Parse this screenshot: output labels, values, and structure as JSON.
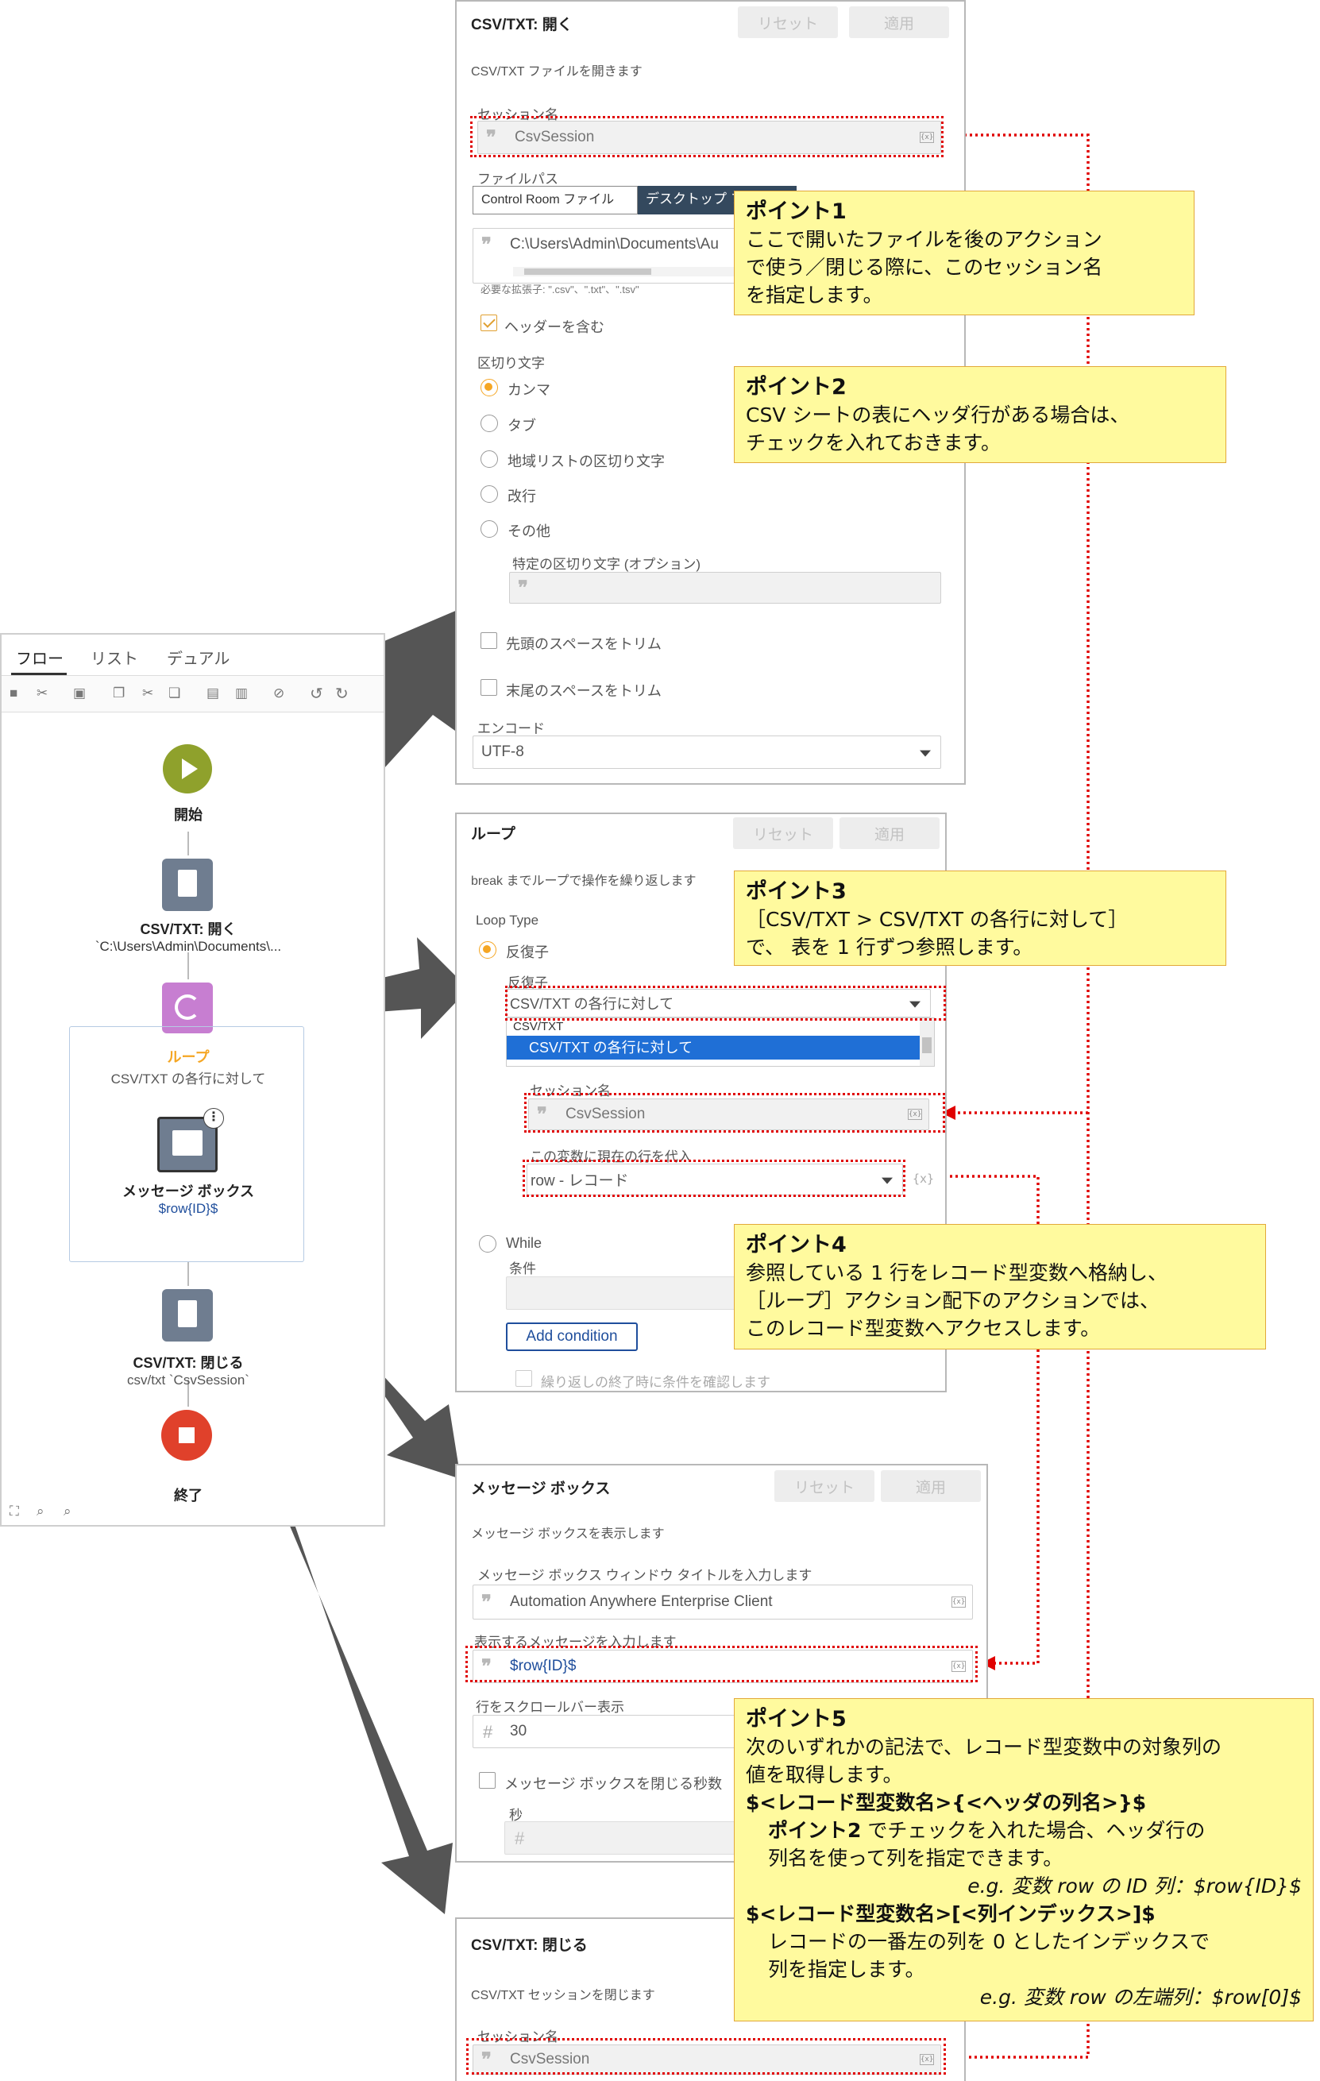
{
  "flow_panel": {
    "tabs": [
      "フロー",
      "リスト",
      "デュアル"
    ],
    "nodes": {
      "start": "開始",
      "open_title": "CSV/TXT: 開く",
      "open_sub": "`C:\\Users\\Admin\\Documents\\...",
      "loop_title": "ループ",
      "loop_sub": "CSV/TXT の各行に対して",
      "msg_title": "メッセージ ボックス",
      "msg_sub": "$row{ID}$",
      "close_title": "CSV/TXT: 閉じる",
      "close_sub": "csv/txt `CsvSession`",
      "end": "終了"
    }
  },
  "open_panel": {
    "title": "CSV/TXT: 開く",
    "reset": "リセット",
    "apply": "適用",
    "desc": "CSV/TXT ファイルを開きます",
    "session_label": "セッション名",
    "session_value": "CsvSession",
    "file_path_label": "ファイルパス",
    "tab_control_room": "Control Room ファイル",
    "tab_desktop": "デスクトップ ファイル",
    "path_value": "C:\\Users\\Admin\\Documents\\Au",
    "extensions": "必要な拡張子: \".csv\"、\".txt\"、\".tsv\"",
    "header_check": "ヘッダーを含む",
    "delimiter_label": "区切り文字",
    "delimiters": [
      "カンマ",
      "タブ",
      "地域リストの区切り文字",
      "改行",
      "その他"
    ],
    "specific_delim": "特定の区切り文字 (オプション)",
    "trim_leading": "先頭のスペースをトリム",
    "trim_trailing": "末尾のスペースをトリム",
    "encode_label": "エンコード",
    "encode_value": "UTF-8"
  },
  "loop_panel": {
    "title": "ループ",
    "reset": "リセット",
    "apply": "適用",
    "desc": "break までループで操作を繰り返します",
    "loop_type": "Loop Type",
    "iterator_radio": "反復子",
    "iterator_label": "反復子",
    "iterator_value": "CSV/TXT の各行に対して",
    "dropdown_group": "CSV/TXT",
    "dropdown_selected": "CSV/TXT の各行に対して",
    "session_label": "セッション名",
    "session_value": "CsvSession",
    "assign_label": "この変数に現在の行を代入",
    "assign_value": "row - レコード",
    "while_radio": "While",
    "condition_label": "条件",
    "add_condition": "Add condition",
    "check_end": "繰り返しの終了時に条件を確認します"
  },
  "msg_panel": {
    "title": "メッセージ ボックス",
    "reset": "リセット",
    "apply": "適用",
    "desc": "メッセージ ボックスを表示します",
    "window_title_label": "メッセージ ボックス ウィンドウ タイトルを入力します",
    "window_title_value": "Automation Anywhere Enterprise Client",
    "message_label": "表示するメッセージを入力します",
    "message_value": "$row{ID}$",
    "scroll_label": "行をスクロールバー表示",
    "scroll_value": "30",
    "close_check": "メッセージ ボックスを閉じる秒数",
    "seconds_label": "秒"
  },
  "close_panel": {
    "title": "CSV/TXT: 閉じる",
    "desc": "CSV/TXT セッションを閉じます",
    "session_label": "セッション名",
    "session_value": "CsvSession"
  },
  "callouts": {
    "p1_title": "ポイント1",
    "p1_text": [
      "ここで開いたファイルを後のアクション",
      "で使う／閉じる際に、このセッション名",
      "を指定します。"
    ],
    "p2_title": "ポイント2",
    "p2_text": [
      "CSV シートの表にヘッダ行がある場合は、",
      "チェックを入れておきます。"
    ],
    "p3_title": "ポイント3",
    "p3_text": [
      "［CSV/TXT > CSV/TXT の各行に対して］",
      "で、 表を 1 行ずつ参照します。"
    ],
    "p4_title": "ポイント4",
    "p4_text": [
      "参照している 1 行をレコード型変数へ格納し、",
      "［ループ］アクション配下のアクションでは、",
      "このレコード型変数へアクセスします。"
    ],
    "p5_title": "ポイント5",
    "p5_line1": "次のいずれかの記法で、レコード型変数中の対象列の",
    "p5_line2": "値を取得します。",
    "p5_syntax1": "$<レコード型変数名>{<ヘッダの列名>}$",
    "p5_s1_bold": "ポイント2",
    "p5_s1_rest": " でチェックを入れた場合、ヘッダ行の",
    "p5_s1_line2": "列名を使って列を指定できます。",
    "p5_s1_example": "e.g. 変数 row の ID 列：$row{ID}$",
    "p5_syntax2": "$<レコード型変数名>[<列インデックス>]$",
    "p5_s2_line1": "レコードの一番左の列を 0 としたインデックスで",
    "p5_s2_line2": "列を指定します。",
    "p5_s2_example": "e.g. 変数 row の左端列：$row[0]$"
  },
  "colors": {
    "highlight_red": "#e00000",
    "callout_fill": "#fffa9e",
    "accent_orange": "#f5a623",
    "loop_purple": "#c77ed1",
    "start_green": "#8fa12c",
    "end_red": "#e0412b"
  }
}
